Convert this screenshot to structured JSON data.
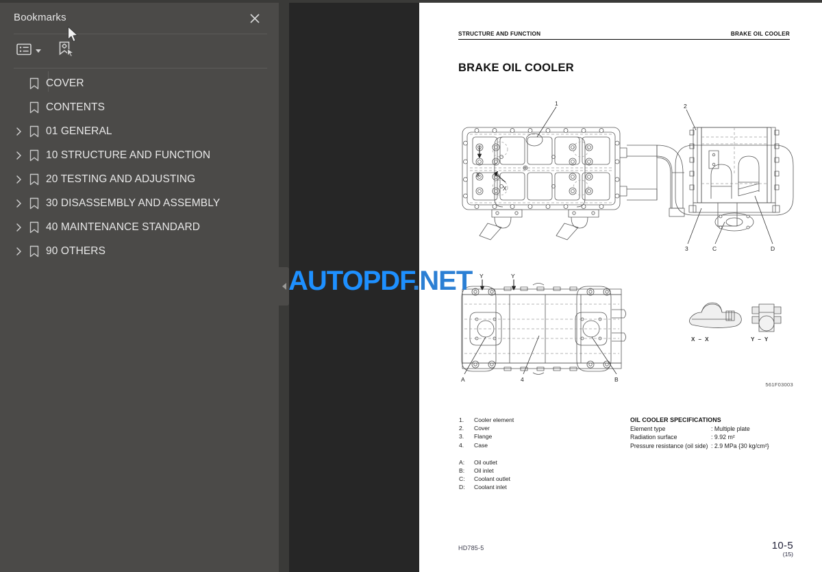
{
  "sidebar": {
    "title": "Bookmarks",
    "close_icon": "close-icon",
    "toolbar": {
      "options_label": "options-icon",
      "new_bookmark_label": "new-bookmark-icon"
    },
    "items": [
      {
        "label": "COVER",
        "expandable": false
      },
      {
        "label": "CONTENTS",
        "expandable": false
      },
      {
        "label": "01 GENERAL",
        "expandable": true
      },
      {
        "label": "10 STRUCTURE AND FUNCTION",
        "expandable": true
      },
      {
        "label": "20 TESTING AND ADJUSTING",
        "expandable": true
      },
      {
        "label": "30 DISASSEMBLY AND ASSEMBLY",
        "expandable": true
      },
      {
        "label": "40 MAINTENANCE STANDARD",
        "expandable": true
      },
      {
        "label": "90 OTHERS",
        "expandable": true
      }
    ]
  },
  "viewer": {
    "collapse_handle_icon": "chevron-left-icon",
    "watermark": {
      "part1": "AUTOPDF",
      "part2": ".NET"
    },
    "accent_color": "#1e90ff",
    "background_color": "#262626"
  },
  "page": {
    "header_left": "STRUCTURE AND FUNCTION",
    "header_right": "BRAKE OIL COOLER",
    "title": "BRAKE OIL COOLER",
    "drawing_number": "561F03003",
    "callouts": {
      "top_view": "1",
      "end_view_2": "2",
      "end_view_3": "3",
      "end_view_c": "C",
      "end_view_d": "D",
      "side_view_a": "A",
      "side_view_b": "B",
      "side_view_4": "4",
      "section_x": "X",
      "section_y": "Y"
    },
    "section_views": [
      {
        "label": "X – X"
      },
      {
        "label": "Y – Y"
      }
    ],
    "legend_numbered": [
      {
        "key": "1.",
        "text": "Cooler element"
      },
      {
        "key": "2.",
        "text": "Cover"
      },
      {
        "key": "3.",
        "text": "Flange"
      },
      {
        "key": "4.",
        "text": "Case"
      }
    ],
    "legend_lettered": [
      {
        "key": "A:",
        "text": "Oil outlet"
      },
      {
        "key": "B:",
        "text": "Oil inlet"
      },
      {
        "key": "C:",
        "text": "Coolant outlet"
      },
      {
        "key": "D:",
        "text": "Coolant inlet"
      }
    ],
    "specifications": {
      "title": "OIL COOLER SPECIFICATIONS",
      "rows": [
        {
          "name": "Element type",
          "value": ": Multiple plate"
        },
        {
          "name": "Radiation surface",
          "value": ": 9.92 m²"
        },
        {
          "name": "Pressure resistance (oil side)",
          "value": ": 2.9 MPa {30 kg/cm²}"
        }
      ]
    },
    "footer_left": "HD785-5",
    "footer_page": "10-5",
    "footer_sub": "(15)"
  }
}
